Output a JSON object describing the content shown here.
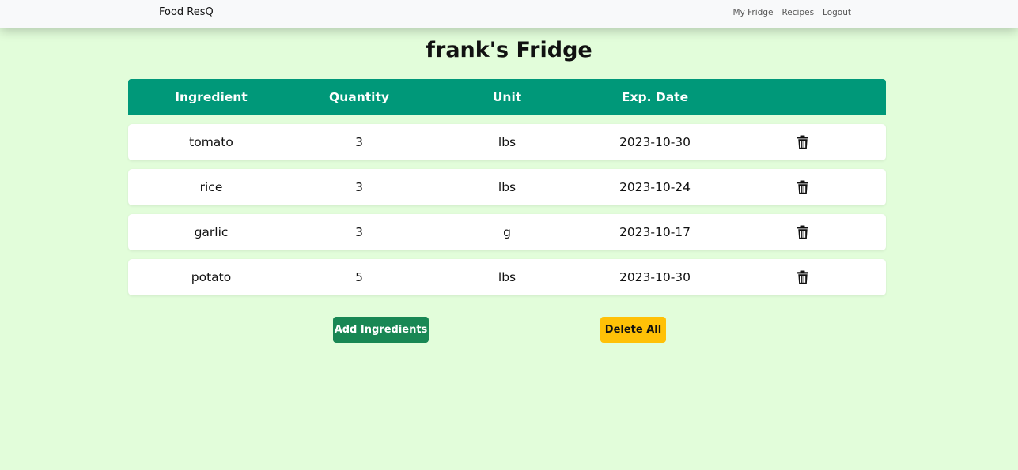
{
  "navbar": {
    "brand": "Food ResQ",
    "links": [
      "My Fridge",
      "Recipes",
      "Logout"
    ]
  },
  "page_title": "frank's Fridge",
  "table": {
    "headers": [
      "Ingredient",
      "Quantity",
      "Unit",
      "Exp. Date",
      ""
    ],
    "rows": [
      {
        "ingredient": "tomato",
        "quantity": "3",
        "unit": "lbs",
        "exp_date": "2023-10-30",
        "action_icon": "trash-icon"
      },
      {
        "ingredient": "rice",
        "quantity": "3",
        "unit": "lbs",
        "exp_date": "2023-10-24",
        "action_icon": "trash-icon"
      },
      {
        "ingredient": "garlic",
        "quantity": "3",
        "unit": "g",
        "exp_date": "2023-10-17",
        "action_icon": "trash-icon"
      },
      {
        "ingredient": "potato",
        "quantity": "5",
        "unit": "lbs",
        "exp_date": "2023-10-30",
        "action_icon": "trash-icon"
      }
    ]
  },
  "actions": {
    "add_label": "Add Ingredients",
    "delete_all_label": "Delete All"
  },
  "colors": {
    "page_background": "#e2fdda",
    "navbar_background": "#f8f9fa",
    "table_header": "#009879",
    "add_button": "#198754",
    "delete_all_button": "#ffc107"
  }
}
